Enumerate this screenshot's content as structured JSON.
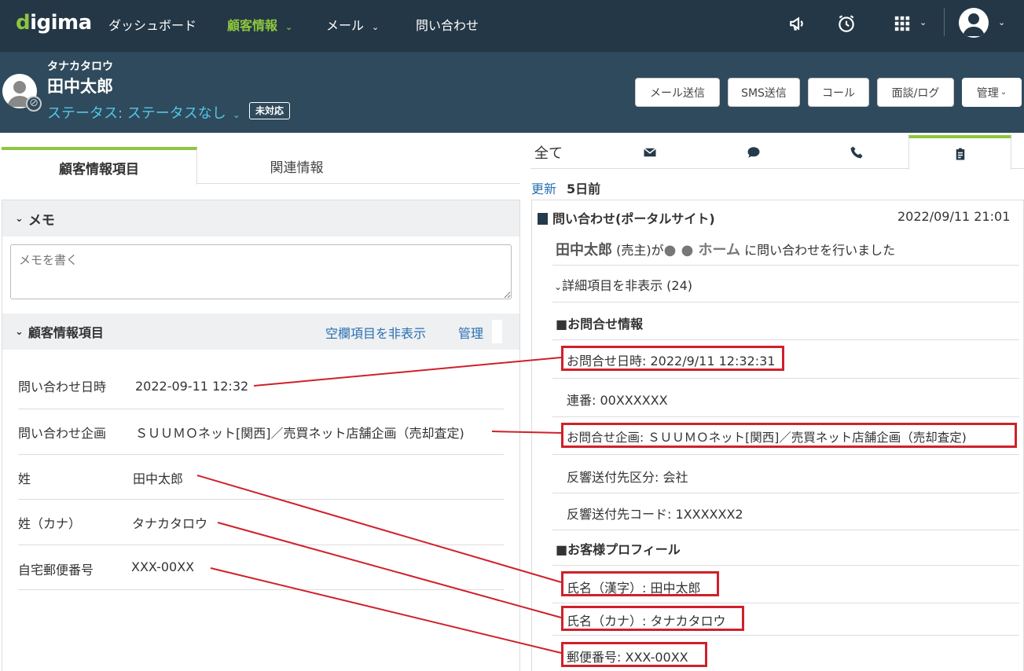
{
  "nav": {
    "logo_prefix": "d",
    "logo_rest": "igima",
    "items": [
      {
        "label": "ダッシュボード"
      },
      {
        "label": "顧客情報"
      },
      {
        "label": "メール"
      },
      {
        "label": "問い合わせ"
      }
    ],
    "icons": [
      "megaphone-icon",
      "alarm-clock-icon",
      "apps-grid-icon",
      "user-avatar-icon"
    ]
  },
  "customer": {
    "kana": "タナカタロウ",
    "name": "田中太郎",
    "status": "ステータス: ステータスなし",
    "badge": "未対応",
    "actions": [
      "メール送信",
      "SMS送信",
      "コール",
      "面談/ログ",
      "管理"
    ]
  },
  "left": {
    "tabs": [
      "顧客情報項目",
      "関連情報"
    ],
    "memo": {
      "title": "メモ",
      "placeholder": "メモを書く"
    },
    "info": {
      "title": "顧客情報項目",
      "hide_empty": "空欄項目を非表示",
      "manage": "管理",
      "fields": [
        {
          "label": "問い合わせ日時",
          "value": "2022-09-11 12:32"
        },
        {
          "label": "問い合わせ企画",
          "value": "ＳＵＵＭＯネット[関西]／売買ネット店舗企画（売却査定)"
        },
        {
          "label": "姓",
          "value": "田中太郎"
        },
        {
          "label": "姓（カナ）",
          "value": "タナカタロウ"
        },
        {
          "label": "自宅郵便番号",
          "value": "XXX-00XX"
        }
      ]
    }
  },
  "right": {
    "tabs": [
      "全て",
      "mail-icon",
      "chat-icon",
      "phone-icon",
      "clipboard-icon"
    ],
    "updated_label": "更新",
    "updated_value": "5日前",
    "event": {
      "title": "問い合わせ(ポータルサイト)",
      "datetime": "2022/09/11 21:01",
      "name": "田中太郎",
      "role": "(売主)が",
      "company": "● ● ホーム",
      "suffix": "に問い合わせを行いました",
      "toggle": "詳細項目を非表示 (24)"
    },
    "sections": {
      "inquiry": "■お問合せ情報",
      "profile": "■お客様プロフィール"
    },
    "rows": [
      "お問合せ日時: 2022/9/11 12:32:31",
      "連番: 00XXXXXX",
      "お問合せ企画: ＳＵＵＭＯネット[関西]／売買ネット店舗企画（売却査定)",
      "反響送付先区分: 会社",
      "反響送付先コード: 1XXXXXX2",
      "氏名（漢字）: 田中太郎",
      "氏名（カナ）: タナカタロウ",
      "郵便番号: XXX-00XX"
    ]
  },
  "colors": {
    "nav_bg": "#243746",
    "header_bg": "#2f4a5c",
    "accent_green": "#8dc63f",
    "status_blue": "#52c7e8",
    "link_blue": "#2a6fb0",
    "annotation_red": "#d0202a"
  }
}
